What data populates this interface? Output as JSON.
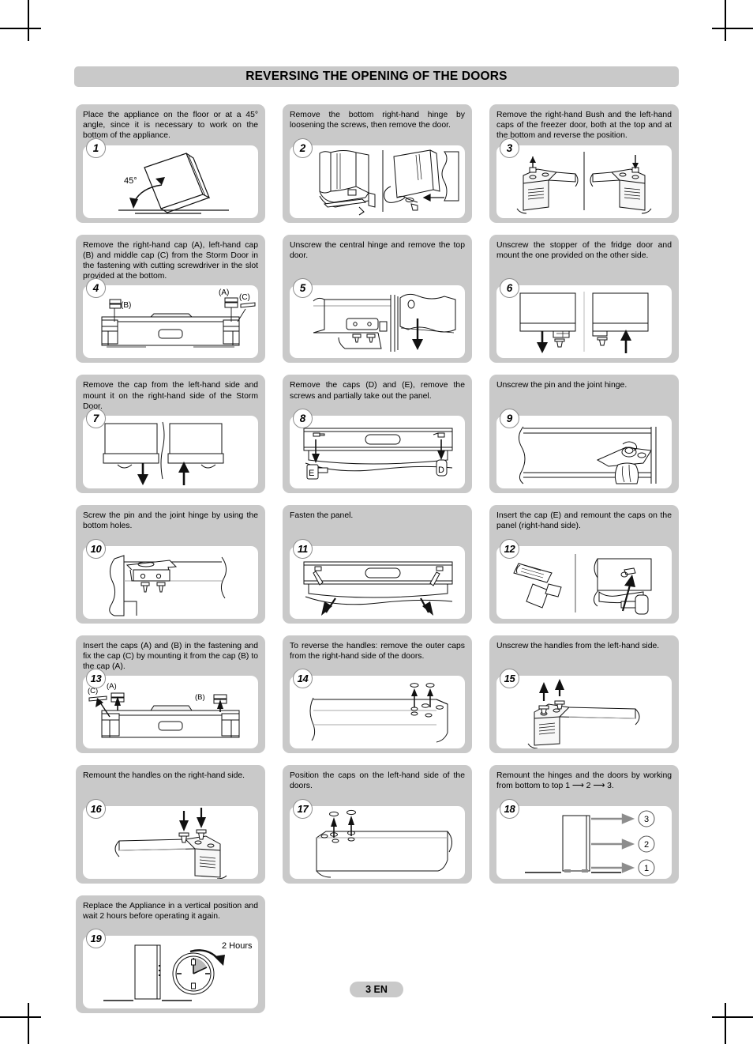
{
  "page": {
    "title": "REVERSING THE OPENING OF THE DOORS",
    "footer_label": "3 EN",
    "colors": {
      "panel_gray": "#c9c9c9",
      "illustration_bg": "#ffffff",
      "ink": "#000000",
      "shade_gray": "#b8b8b8"
    }
  },
  "steps": [
    {
      "number": "1",
      "caption": "Place the appliance on the floor or at a 45° angle, since it is necessary to work on the bottom of the appliance.",
      "art_labels": [
        "45°"
      ]
    },
    {
      "number": "2",
      "caption": "Remove the bottom right-hand hinge by loosening the screws, then remove the door.",
      "art_labels": []
    },
    {
      "number": "3",
      "caption": "Remove the right-hand Bush and the left-hand caps of the freezer door, both at the top and at the bottom and reverse the position.",
      "art_labels": []
    },
    {
      "number": "4",
      "caption": "Remove the right-hand cap (A), left-hand cap (B) and middle cap (C) from the Storm Door in the fastening with cutting screwdriver in the slot provided at the bottom.",
      "art_labels": [
        "(A)",
        "(B)",
        "(C)"
      ]
    },
    {
      "number": "5",
      "caption": "Unscrew the central hinge and remove the top door.",
      "art_labels": []
    },
    {
      "number": "6",
      "caption": "Unscrew the stopper of the fridge door and mount the one provided on the other side.",
      "art_labels": []
    },
    {
      "number": "7",
      "caption": "Remove the cap from the left-hand side and mount it on the right-hand side of the Storm Door.",
      "art_labels": []
    },
    {
      "number": "8",
      "caption": "Remove the caps (D) and (E), remove the screws and partially take out the panel.",
      "art_labels": [
        "E",
        "D"
      ]
    },
    {
      "number": "9",
      "caption": "Unscrew the pin and the joint hinge.",
      "art_labels": []
    },
    {
      "number": "10",
      "caption": "Screw the pin and the joint hinge by using the bottom holes.",
      "art_labels": []
    },
    {
      "number": "11",
      "caption": "Fasten the panel.",
      "art_labels": []
    },
    {
      "number": "12",
      "caption": "Insert the cap (E) and remount the caps on the panel (right-hand side).",
      "art_labels": []
    },
    {
      "number": "13",
      "caption": "Insert the caps (A) and (B) in the fastening and fix the cap (C) by mounting it from the cap (B) to the cap (A).",
      "art_labels": [
        "(C)",
        "(A)",
        "(B)"
      ]
    },
    {
      "number": "14",
      "caption": "To reverse the handles: remove the outer caps from the right-hand side of the doors.",
      "art_labels": []
    },
    {
      "number": "15",
      "caption": "Unscrew the handles from the left-hand side.",
      "art_labels": []
    },
    {
      "number": "16",
      "caption": "Remount the handles on the right-hand side.",
      "art_labels": []
    },
    {
      "number": "17",
      "caption": "Position the caps on the left-hand side of the doors.",
      "art_labels": []
    },
    {
      "number": "18",
      "caption": "Remount the hinges and the doors by working from bottom to top 1 ⟶ 2 ⟶ 3.",
      "art_labels": [
        "3",
        "2",
        "1"
      ]
    },
    {
      "number": "19",
      "caption": "Replace the Appliance in a vertical position and wait 2 hours before operating it again.",
      "art_labels": [
        "2 Hours"
      ]
    }
  ]
}
